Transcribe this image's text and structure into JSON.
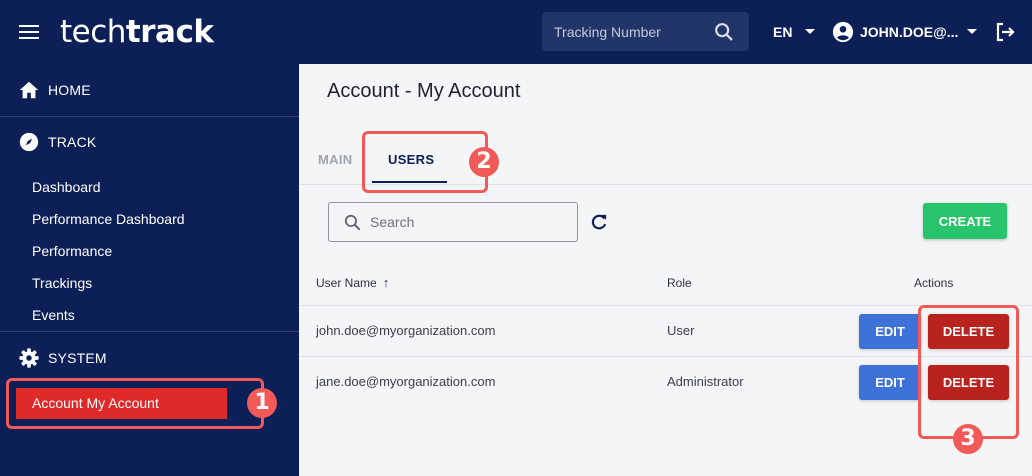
{
  "header": {
    "logo_light": "tech",
    "logo_bold": "track",
    "tracking_placeholder": "Tracking Number",
    "language": "EN",
    "user": "JOHN.DOE@..."
  },
  "sidebar": {
    "sections": [
      {
        "label": "HOME",
        "icon": "home-icon"
      },
      {
        "label": "TRACK",
        "icon": "compass-icon"
      },
      {
        "label": "SYSTEM",
        "icon": "gear-icon"
      }
    ],
    "track_items": [
      "Dashboard",
      "Performance Dashboard",
      "Performance",
      "Trackings",
      "Events"
    ],
    "system_items": [
      "Account My Account"
    ]
  },
  "main": {
    "page_title": "Account - My Account",
    "tabs": [
      {
        "label": "MAIN",
        "active": false
      },
      {
        "label": "USERS",
        "active": true
      }
    ],
    "search_placeholder": "Search",
    "create_label": "CREATE",
    "columns": {
      "user_name": "User Name",
      "role": "Role",
      "actions": "Actions"
    },
    "sort_indicator": "↑",
    "rows": [
      {
        "user": "john.doe@myorganization.com",
        "role": "User",
        "edit": "EDIT",
        "delete": "DELETE"
      },
      {
        "user": "jane.doe@myorganization.com",
        "role": "Administrator",
        "edit": "EDIT",
        "delete": "DELETE"
      }
    ]
  },
  "callouts": [
    "1",
    "2",
    "3"
  ],
  "colors": {
    "navy": "#0c1f57",
    "active_red": "#e02a2a",
    "create_green": "#27c46b",
    "edit_blue": "#3f72d8",
    "delete_red": "#b8231e",
    "callout": "#f25a57"
  }
}
